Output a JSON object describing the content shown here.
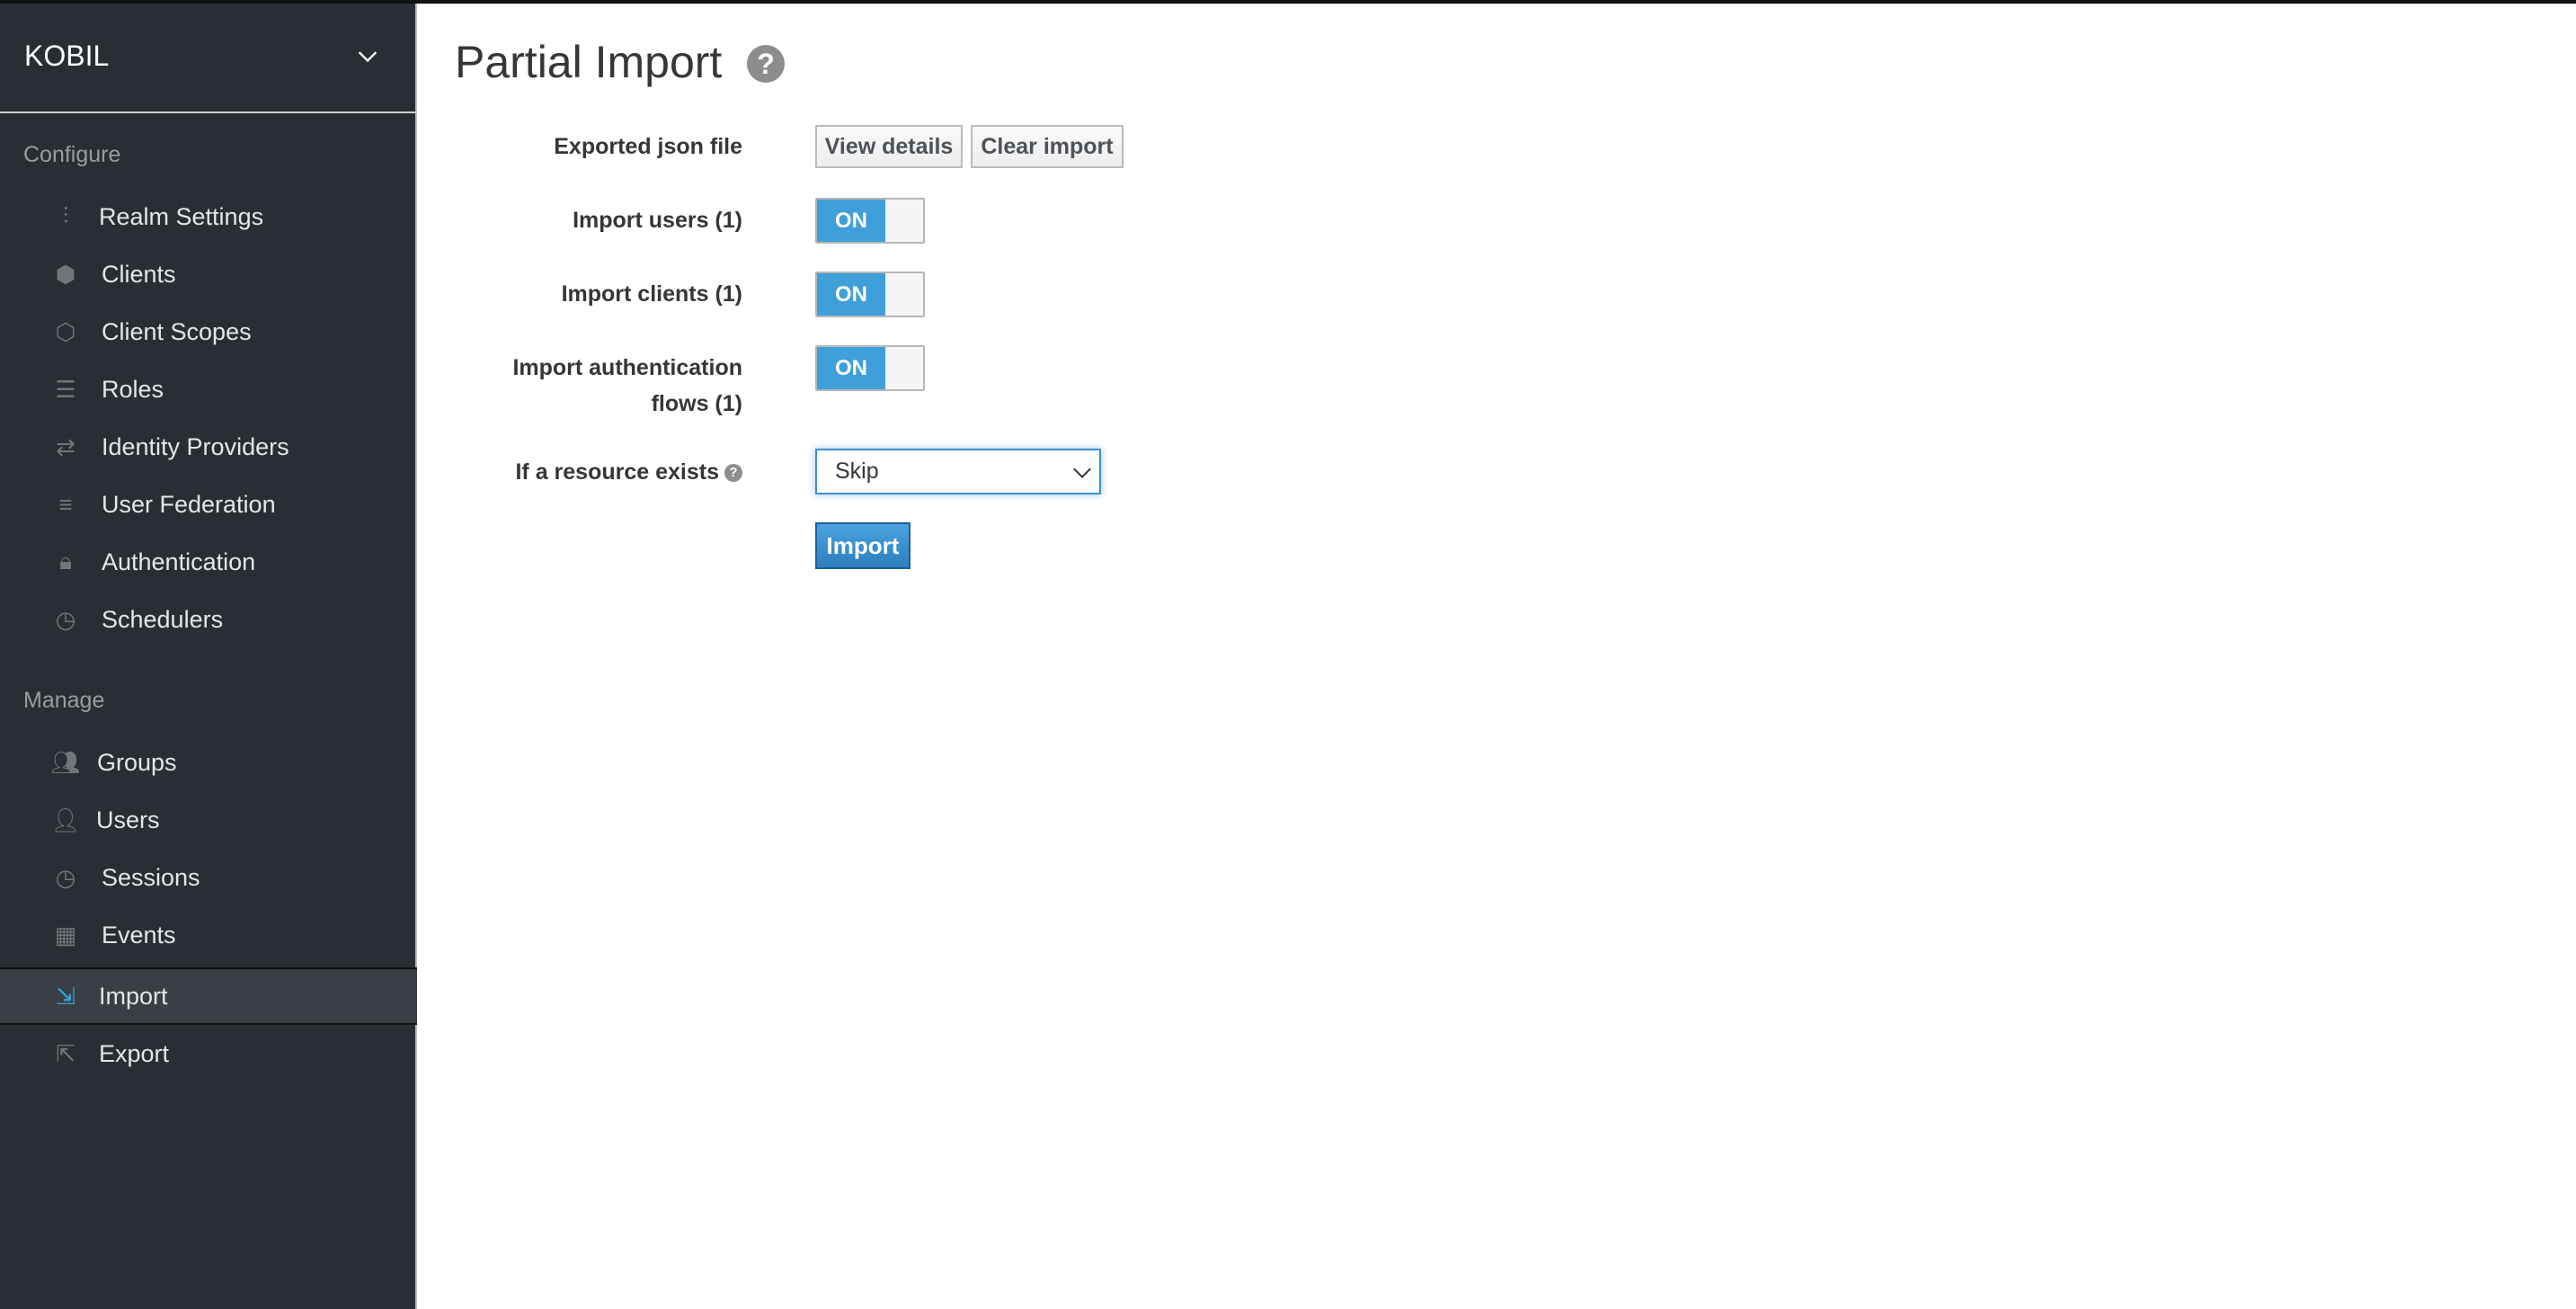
{
  "sidebar": {
    "realm": "KOBIL",
    "configure_label": "Configure",
    "configure_items": [
      {
        "label": "Realm Settings",
        "icon": "sliders-icon"
      },
      {
        "label": "Clients",
        "icon": "cube-icon"
      },
      {
        "label": "Client Scopes",
        "icon": "cubes-icon"
      },
      {
        "label": "Roles",
        "icon": "list-icon"
      },
      {
        "label": "Identity Providers",
        "icon": "exchange-icon"
      },
      {
        "label": "User Federation",
        "icon": "database-icon"
      },
      {
        "label": "Authentication",
        "icon": "lock-icon"
      },
      {
        "label": "Schedulers",
        "icon": "clock-icon"
      }
    ],
    "manage_label": "Manage",
    "manage_items": [
      {
        "label": "Groups",
        "icon": "users-icon"
      },
      {
        "label": "Users",
        "icon": "user-icon"
      },
      {
        "label": "Sessions",
        "icon": "clock-icon"
      },
      {
        "label": "Events",
        "icon": "calendar-icon"
      },
      {
        "label": "Import",
        "icon": "import-icon",
        "active": true
      },
      {
        "label": "Export",
        "icon": "export-icon"
      }
    ],
    "accent_color": "#39a5dc"
  },
  "main": {
    "title": "Partial Import",
    "help_icon": "?",
    "exported_label": "Exported json file",
    "view_details": "View details",
    "clear_import": "Clear import",
    "toggles": [
      {
        "label": "Import users (1)",
        "state": "ON"
      },
      {
        "label": "Import clients (1)",
        "state": "ON"
      },
      {
        "label_line1": "Import authentication",
        "label_line2": "flows (1)",
        "state": "ON"
      }
    ],
    "resource_label": "If a resource exists",
    "resource_value": "Skip",
    "import_button": "Import"
  }
}
